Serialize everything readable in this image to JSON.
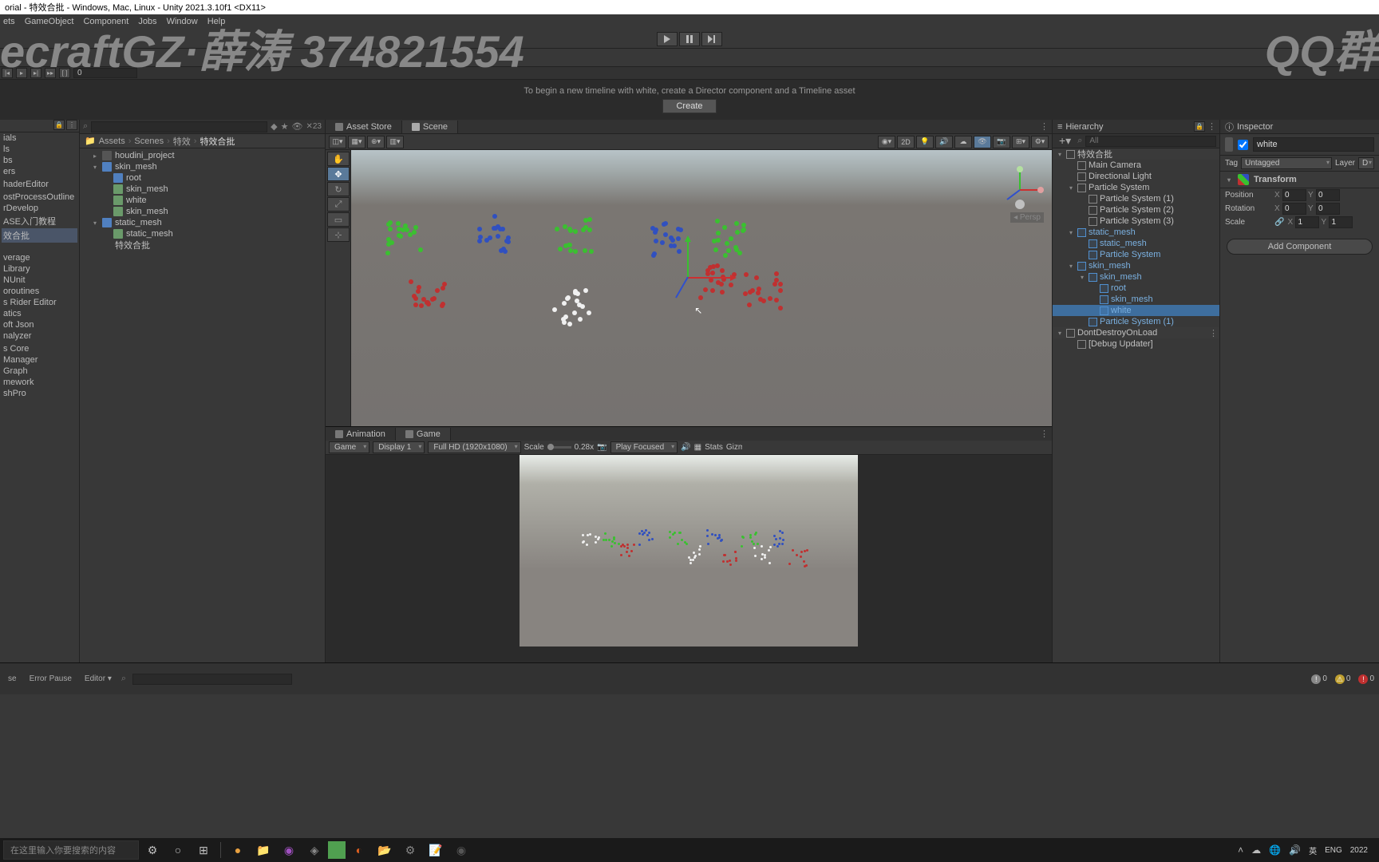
{
  "window": {
    "title": "orial - 特效合批 - Windows, Mac, Linux - Unity 2021.3.10f1 <DX11>"
  },
  "watermarks": {
    "left": "ecraftGZ·薛涛 374821554",
    "right": "QQ群"
  },
  "menubar": [
    "ets",
    "GameObject",
    "Component",
    "Jobs",
    "Window",
    "Help"
  ],
  "timeline": {
    "frame": "0",
    "message": "To begin a new timeline with white, create a Director component and a Timeline asset",
    "create": "Create"
  },
  "left_sidebar": {
    "items_top": [
      "ials",
      "ls",
      "bs",
      "ers",
      "",
      "haderEditor",
      "",
      "ostProcessOutline",
      "rDevelop",
      "ASE入门教程"
    ],
    "items_sel": "效合批",
    "items_bot": [
      "verage",
      "Library",
      "NUnit",
      "oroutines",
      "s Rider Editor",
      "atics",
      "oft Json",
      "nalyzer",
      "",
      "s Core",
      "Manager",
      "Graph",
      "mework",
      "shPro"
    ]
  },
  "project": {
    "breadcrumb": [
      "Assets",
      "Scenes",
      "特效",
      "特效合批"
    ],
    "count_label": "23",
    "tree": [
      {
        "name": "houdini_project",
        "indent": 1,
        "type": "folder",
        "fold": "▸"
      },
      {
        "name": "skin_mesh",
        "indent": 1,
        "type": "prefab",
        "fold": "▾"
      },
      {
        "name": "root",
        "indent": 2,
        "type": "prefab",
        "fold": ""
      },
      {
        "name": "skin_mesh",
        "indent": 2,
        "type": "mesh",
        "fold": ""
      },
      {
        "name": "white",
        "indent": 2,
        "type": "mesh",
        "fold": ""
      },
      {
        "name": "skin_mesh",
        "indent": 2,
        "type": "mesh",
        "fold": ""
      },
      {
        "name": "static_mesh",
        "indent": 1,
        "type": "prefab",
        "fold": "▾"
      },
      {
        "name": "static_mesh",
        "indent": 2,
        "type": "mesh",
        "fold": ""
      },
      {
        "name": "特效合批",
        "indent": 1,
        "type": "scene",
        "fold": ""
      }
    ]
  },
  "center": {
    "tabs": [
      "Asset Store",
      "Scene"
    ],
    "scene_toolbar_2d": "2D",
    "persp": "Persp",
    "game_tabs": [
      "Animation",
      "Game"
    ],
    "game_toolbar": {
      "render": "Game",
      "display": "Display 1",
      "resolution": "Full HD (1920x1080)",
      "scale_label": "Scale",
      "scale": "0.28x",
      "play_mode": "Play Focused",
      "stats": "Stats",
      "gizmos": "Gizmos"
    }
  },
  "hierarchy": {
    "title": "Hierarchy",
    "search_placeholder": "All",
    "items": [
      {
        "name": "特效合批",
        "indent": 0,
        "fold": "▾",
        "prefab": false,
        "scene": true
      },
      {
        "name": "Main Camera",
        "indent": 1,
        "fold": "",
        "prefab": false
      },
      {
        "name": "Directional Light",
        "indent": 1,
        "fold": "",
        "prefab": false
      },
      {
        "name": "Particle System",
        "indent": 1,
        "fold": "▾",
        "prefab": false
      },
      {
        "name": "Particle System (1)",
        "indent": 2,
        "fold": "",
        "prefab": false
      },
      {
        "name": "Particle System (2)",
        "indent": 2,
        "fold": "",
        "prefab": false
      },
      {
        "name": "Particle System (3)",
        "indent": 2,
        "fold": "",
        "prefab": false
      },
      {
        "name": "static_mesh",
        "indent": 1,
        "fold": "▾",
        "prefab": true
      },
      {
        "name": "static_mesh",
        "indent": 2,
        "fold": "",
        "prefab": true
      },
      {
        "name": "Particle System",
        "indent": 2,
        "fold": "",
        "prefab": true
      },
      {
        "name": "skin_mesh",
        "indent": 1,
        "fold": "▾",
        "prefab": true
      },
      {
        "name": "skin_mesh",
        "indent": 2,
        "fold": "▾",
        "prefab": true
      },
      {
        "name": "root",
        "indent": 3,
        "fold": "",
        "prefab": true
      },
      {
        "name": "skin_mesh",
        "indent": 3,
        "fold": "",
        "prefab": true
      },
      {
        "name": "white",
        "indent": 3,
        "fold": "",
        "prefab": true,
        "selected": true
      },
      {
        "name": "Particle System (1)",
        "indent": 2,
        "fold": "",
        "prefab": true
      },
      {
        "name": "DontDestroyOnLoad",
        "indent": 0,
        "fold": "▾",
        "prefab": false,
        "scene": true
      },
      {
        "name": "[Debug Updater]",
        "indent": 1,
        "fold": "",
        "prefab": false
      }
    ]
  },
  "inspector": {
    "title": "Inspector",
    "enabled": true,
    "name": "white",
    "tag_label": "Tag",
    "tag": "Untagged",
    "layer_label": "Layer",
    "layer": "D",
    "transform": {
      "title": "Transform",
      "position_label": "Position",
      "rotation_label": "Rotation",
      "scale_label": "Scale",
      "pos": {
        "x": "0",
        "y": "0"
      },
      "rot": {
        "x": "0",
        "y": "0"
      },
      "scl": {
        "x": "1",
        "y": "1"
      }
    },
    "add_component": "Add Component"
  },
  "console": {
    "buttons": [
      "se",
      "Error Pause",
      "Editor ▾"
    ],
    "counts": {
      "info": "0",
      "warn": "0",
      "error": "0"
    }
  },
  "taskbar": {
    "search_placeholder": "在这里输入你要搜索的内容",
    "right": {
      "ime": "英",
      "lang": "ENG",
      "date_y": "2022"
    }
  }
}
